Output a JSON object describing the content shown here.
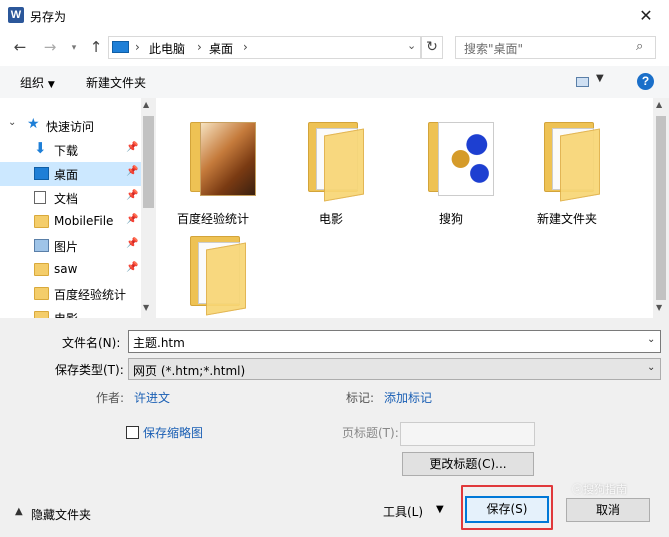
{
  "window": {
    "title": "另存为",
    "app_icon_letter": "W",
    "close_glyph": "✕"
  },
  "address": {
    "crumbs": [
      "此电脑",
      "桌面"
    ],
    "separator": "›",
    "search_placeholder": "搜索\"桌面\""
  },
  "toolbar": {
    "organize_label": "组织",
    "new_folder_label": "新建文件夹",
    "help_glyph": "?"
  },
  "nav": {
    "quick_access_label": "快速访问",
    "items": [
      {
        "label": "下载",
        "icon": "download-arrow-icon",
        "pinned": true
      },
      {
        "label": "桌面",
        "icon": "desktop-icon",
        "pinned": true,
        "selected": true
      },
      {
        "label": "文档",
        "icon": "document-icon",
        "pinned": true
      },
      {
        "label": "MobileFile",
        "icon": "folder-icon",
        "pinned": true
      },
      {
        "label": "图片",
        "icon": "picture-icon",
        "pinned": true
      },
      {
        "label": "saw",
        "icon": "folder-icon",
        "pinned": true
      },
      {
        "label": "百度经验统计",
        "icon": "folder-icon",
        "pinned": false
      },
      {
        "label": "电影",
        "icon": "folder-icon",
        "pinned": false
      }
    ]
  },
  "files": [
    {
      "label": "百度经验统计",
      "kind": "photo-folder"
    },
    {
      "label": "电影",
      "kind": "folder"
    },
    {
      "label": "搜狗",
      "kind": "photo-folder"
    },
    {
      "label": "新建文件夹",
      "kind": "folder"
    },
    {
      "label": "",
      "kind": "folder"
    }
  ],
  "form": {
    "filename_label": "文件名(N):",
    "filename_value": "主题.htm",
    "filetype_label": "保存类型(T):",
    "filetype_value": "网页 (*.htm;*.html)",
    "author_label": "作者:",
    "author_value": "许进文",
    "tags_label": "标记:",
    "tags_value": "添加标记",
    "thumbnail_label": "保存缩略图",
    "page_title_label": "页标题(T):",
    "change_title_label": "更改标题(C)..."
  },
  "footer": {
    "hide_folders_label": "隐藏文件夹",
    "tools_label": "工具(L)",
    "save_label": "保存(S)",
    "cancel_label": "取消"
  },
  "watermark": "ⓢ搜狗指南"
}
